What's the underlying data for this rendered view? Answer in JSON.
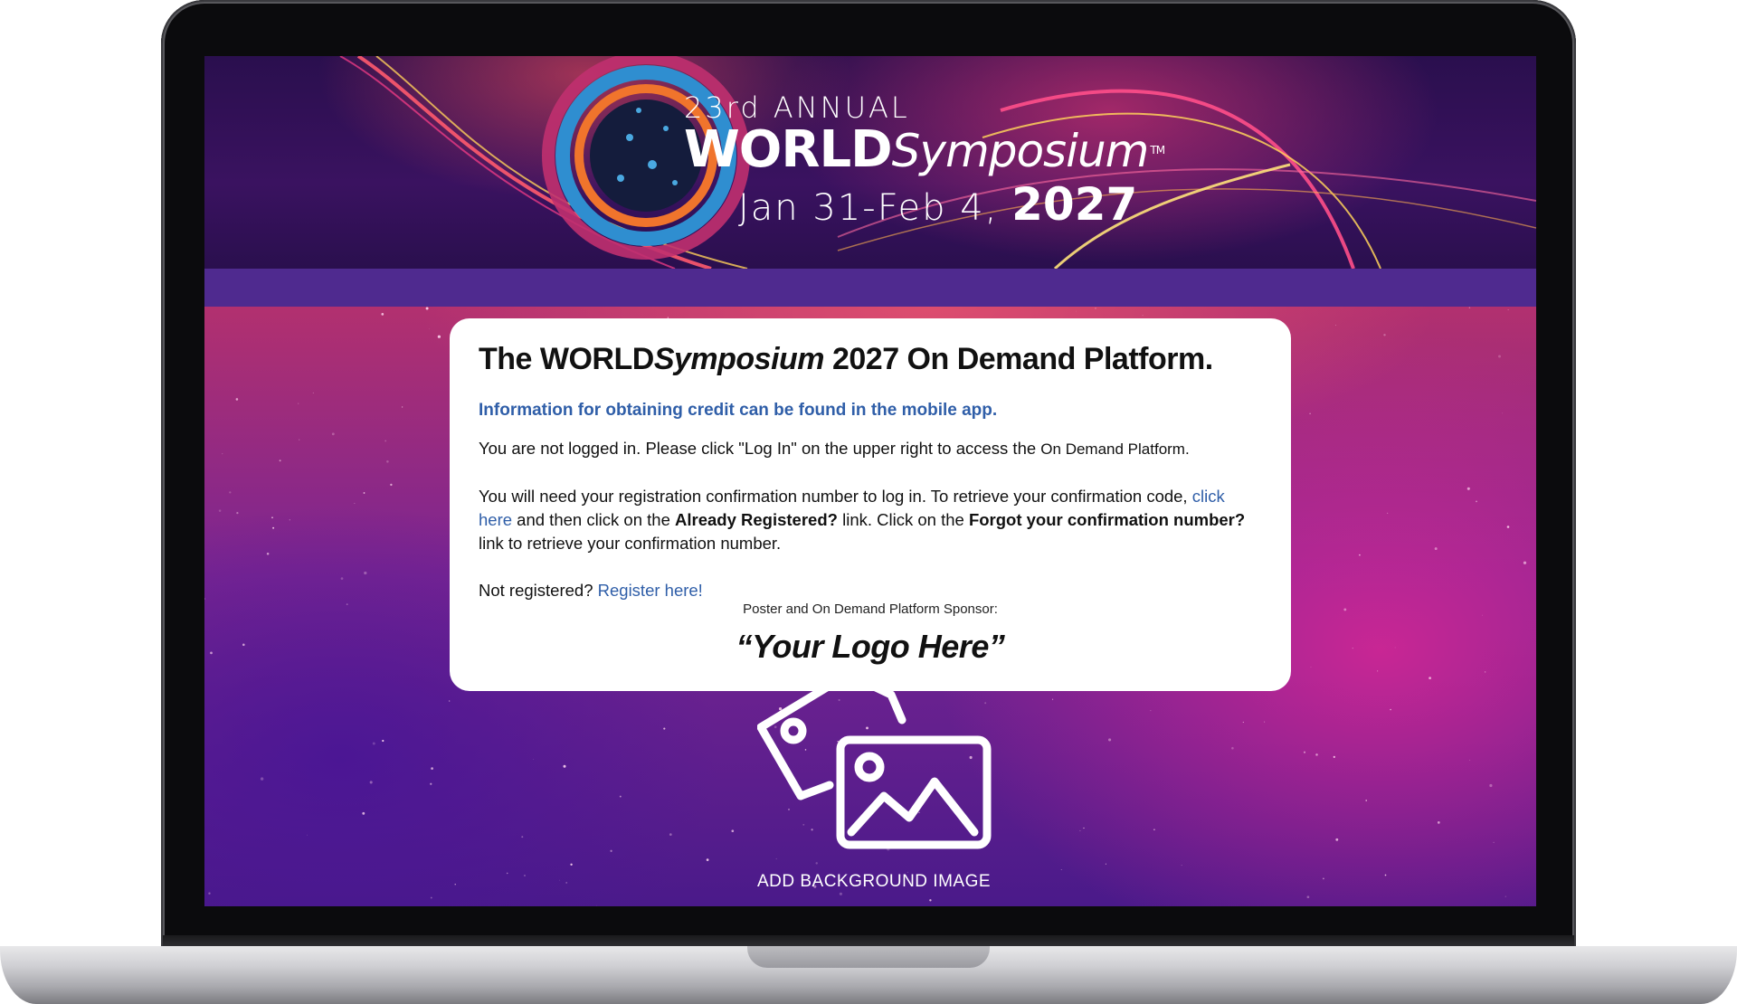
{
  "banner": {
    "annual": "23rd ANNUAL",
    "brand_bold": "WORLD",
    "brand_italic": "Symposium",
    "trademark": "TM",
    "dates_prefix": "Jan 31-Feb 4,",
    "dates_year": "2027"
  },
  "card": {
    "title_pre": "The WORLD",
    "title_italic": "Symposium",
    "title_post": " 2027 On Demand Platform.",
    "info": "Information for obtaining credit can be found in the mobile app.",
    "not_logged_in": "You are not logged in. Please click \"Log In\" on the upper right to access the ",
    "platform_name": "On Demand Platform.",
    "confirm_text_1": "You will need your registration confirmation number to log in. To retrieve your confirmation code, ",
    "click_here": "click here",
    "confirm_text_2": " and then click on the ",
    "already_registered": "Already Registered?",
    "confirm_text_3": " link. Click on the ",
    "forgot_confirmation": "Forgot your confirmation number?",
    "confirm_text_4": " link to retrieve your confirmation number.",
    "not_registered": "Not registered? ",
    "register_link": "Register here!",
    "sponsor_label": "Poster and On Demand Platform Sponsor:",
    "logo_placeholder": "“Your Logo Here”"
  },
  "background": {
    "add_image_label": "ADD BACKGROUND IMAGE",
    "icon": "image-gallery-icon"
  },
  "colors": {
    "link": "#2f5ea8",
    "purple_bar": "#4f2a8f",
    "card_bg": "#ffffff"
  }
}
